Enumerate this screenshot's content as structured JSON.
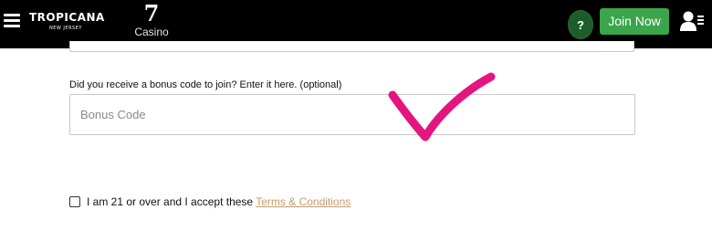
{
  "header": {
    "brand_name": "TROPICANA",
    "brand_sub": "NEW JERSEY",
    "casino_numeral": "7",
    "casino_label": "Casino",
    "help_label": "?",
    "join_label": "Join Now"
  },
  "form": {
    "bonus_label": "Did you receive a bonus code to join? Enter it here. (optional)",
    "bonus_placeholder": "Bonus Code",
    "bonus_value": "",
    "terms_text": "I am 21 or over and I accept these",
    "terms_link": "Terms & Conditions",
    "terms_checked": false
  },
  "colors": {
    "header_bg": "#000000",
    "join_button": "#3aa54a",
    "help_button": "#1d5d2a",
    "terms_link": "#c49a6c",
    "overlay_mark": "#e4157f"
  },
  "icons": {
    "menu": "hamburger-icon",
    "account": "account-icon",
    "overlay": "checkmark-annotation"
  }
}
